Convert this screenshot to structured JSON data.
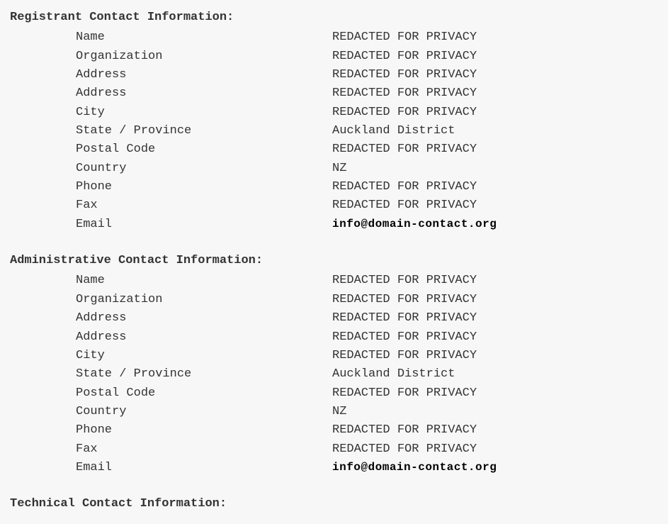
{
  "sections": {
    "registrant": {
      "heading": "Registrant Contact Information:",
      "fields": [
        {
          "label": "Name",
          "value": "REDACTED FOR PRIVACY",
          "is_email": false
        },
        {
          "label": "Organization",
          "value": "REDACTED FOR PRIVACY",
          "is_email": false
        },
        {
          "label": "Address",
          "value": "REDACTED FOR PRIVACY",
          "is_email": false
        },
        {
          "label": "Address",
          "value": "REDACTED FOR PRIVACY",
          "is_email": false
        },
        {
          "label": "City",
          "value": "REDACTED FOR PRIVACY",
          "is_email": false
        },
        {
          "label": "State / Province",
          "value": "Auckland District",
          "is_email": false
        },
        {
          "label": "Postal Code",
          "value": "REDACTED FOR PRIVACY",
          "is_email": false
        },
        {
          "label": "Country",
          "value": "NZ",
          "is_email": false
        },
        {
          "label": "Phone",
          "value": "REDACTED FOR PRIVACY",
          "is_email": false
        },
        {
          "label": "Fax",
          "value": "REDACTED FOR PRIVACY",
          "is_email": false
        },
        {
          "label": "Email",
          "value": "info@domain-contact.org",
          "is_email": true
        }
      ]
    },
    "administrative": {
      "heading": "Administrative Contact Information:",
      "fields": [
        {
          "label": "Name",
          "value": "REDACTED FOR PRIVACY",
          "is_email": false
        },
        {
          "label": "Organization",
          "value": "REDACTED FOR PRIVACY",
          "is_email": false
        },
        {
          "label": "Address",
          "value": "REDACTED FOR PRIVACY",
          "is_email": false
        },
        {
          "label": "Address",
          "value": "REDACTED FOR PRIVACY",
          "is_email": false
        },
        {
          "label": "City",
          "value": "REDACTED FOR PRIVACY",
          "is_email": false
        },
        {
          "label": "State / Province",
          "value": "Auckland District",
          "is_email": false
        },
        {
          "label": "Postal Code",
          "value": "REDACTED FOR PRIVACY",
          "is_email": false
        },
        {
          "label": "Country",
          "value": "NZ",
          "is_email": false
        },
        {
          "label": "Phone",
          "value": "REDACTED FOR PRIVACY",
          "is_email": false
        },
        {
          "label": "Fax",
          "value": "REDACTED FOR PRIVACY",
          "is_email": false
        },
        {
          "label": "Email",
          "value": "info@domain-contact.org",
          "is_email": true
        }
      ]
    },
    "technical": {
      "heading": "Technical Contact Information:"
    }
  }
}
